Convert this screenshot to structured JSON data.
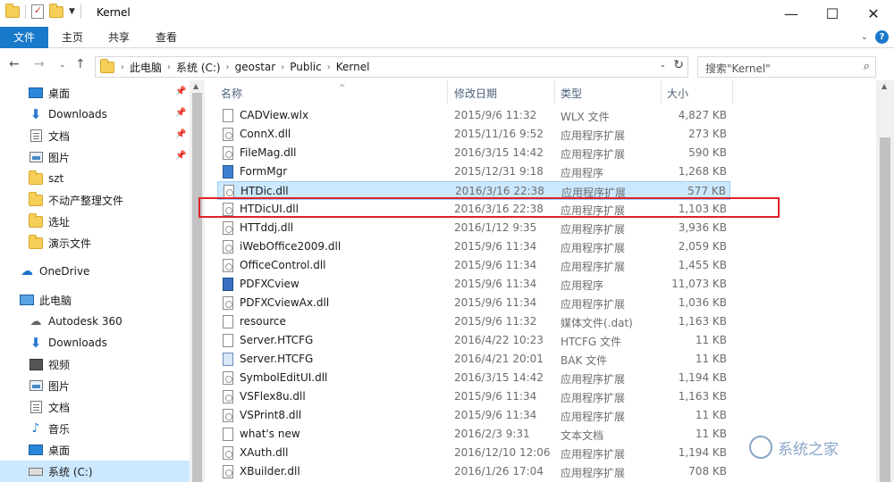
{
  "window": {
    "title": "Kernel",
    "controls": [
      "—",
      "☐",
      "✕"
    ]
  },
  "ribbon": {
    "tabs": [
      "文件",
      "主页",
      "共享",
      "查看"
    ]
  },
  "address": {
    "crumbs": [
      "此电脑",
      "系统 (C:)",
      "geostar",
      "Public",
      "Kernel"
    ]
  },
  "search": {
    "placeholder": "搜索\"Kernel\""
  },
  "nav": {
    "items": [
      {
        "label": "桌面",
        "icon": "desktop-icon",
        "pinned": true
      },
      {
        "label": "Downloads",
        "icon": "downloads-icon",
        "pinned": true
      },
      {
        "label": "文档",
        "icon": "documents-icon",
        "pinned": true
      },
      {
        "label": "图片",
        "icon": "pictures-icon",
        "pinned": true
      },
      {
        "label": "szt",
        "icon": "folder-icon",
        "pinned": false
      },
      {
        "label": "不动产整理文件",
        "icon": "folder-icon",
        "pinned": false
      },
      {
        "label": "选址",
        "icon": "folder-icon",
        "pinned": false
      },
      {
        "label": "演示文件",
        "icon": "folder-icon",
        "pinned": false
      },
      {
        "label": "OneDrive",
        "icon": "onedrive-icon",
        "pinned": false
      },
      {
        "label": "此电脑",
        "icon": "this-pc-icon",
        "pinned": false
      },
      {
        "label": "Autodesk 360",
        "icon": "network-location-icon",
        "pinned": false
      },
      {
        "label": "Downloads",
        "icon": "downloads-icon",
        "pinned": false
      },
      {
        "label": "视频",
        "icon": "videos-icon",
        "pinned": false
      },
      {
        "label": "图片",
        "icon": "pictures-icon",
        "pinned": false
      },
      {
        "label": "文档",
        "icon": "documents-icon",
        "pinned": false
      },
      {
        "label": "音乐",
        "icon": "music-icon",
        "pinned": false
      },
      {
        "label": "桌面",
        "icon": "desktop-icon",
        "pinned": false
      },
      {
        "label": "系统 (C:)",
        "icon": "drive-icon",
        "pinned": false
      }
    ]
  },
  "columns": {
    "name": "名称",
    "date": "修改日期",
    "type": "类型",
    "size": "大小"
  },
  "files": [
    {
      "name": "CADView.wlx",
      "date": "2015/9/6 11:32",
      "type": "WLX 文件",
      "size": "4,827 KB",
      "icon": "file-icon"
    },
    {
      "name": "ConnX.dll",
      "date": "2015/11/16 9:52",
      "type": "应用程序扩展",
      "size": "273 KB",
      "icon": "dll-icon"
    },
    {
      "name": "FileMag.dll",
      "date": "2016/3/15 14:42",
      "type": "应用程序扩展",
      "size": "590 KB",
      "icon": "dll-icon"
    },
    {
      "name": "FormMgr",
      "date": "2015/12/31 9:18",
      "type": "应用程序",
      "size": "1,268 KB",
      "icon": "exe-icon"
    },
    {
      "name": "HTDic.dll",
      "date": "2016/3/16 22:38",
      "type": "应用程序扩展",
      "size": "577 KB",
      "icon": "dll-icon"
    },
    {
      "name": "HTDicUI.dll",
      "date": "2016/3/16 22:38",
      "type": "应用程序扩展",
      "size": "1,103 KB",
      "icon": "dll-icon"
    },
    {
      "name": "HTTddj.dll",
      "date": "2016/1/12 9:35",
      "type": "应用程序扩展",
      "size": "3,936 KB",
      "icon": "dll-icon"
    },
    {
      "name": "iWebOffice2009.dll",
      "date": "2015/9/6 11:34",
      "type": "应用程序扩展",
      "size": "2,059 KB",
      "icon": "dll-icon"
    },
    {
      "name": "OfficeControl.dll",
      "date": "2015/9/6 11:34",
      "type": "应用程序扩展",
      "size": "1,455 KB",
      "icon": "dll-icon"
    },
    {
      "name": "PDFXCview",
      "date": "2015/9/6 11:34",
      "type": "应用程序",
      "size": "11,073 KB",
      "icon": "pdf-app-icon"
    },
    {
      "name": "PDFXCviewAx.dll",
      "date": "2015/9/6 11:34",
      "type": "应用程序扩展",
      "size": "1,036 KB",
      "icon": "dll-icon"
    },
    {
      "name": "resource",
      "date": "2015/9/6 11:32",
      "type": "媒体文件(.dat)",
      "size": "1,163 KB",
      "icon": "file-icon"
    },
    {
      "name": "Server.HTCFG",
      "date": "2016/4/22 10:23",
      "type": "HTCFG 文件",
      "size": "11 KB",
      "icon": "file-icon"
    },
    {
      "name": "Server.HTCFG",
      "date": "2016/4/21 20:01",
      "type": "BAK 文件",
      "size": "11 KB",
      "icon": "cfg-icon"
    },
    {
      "name": "SymbolEditUI.dll",
      "date": "2016/3/15 14:42",
      "type": "应用程序扩展",
      "size": "1,194 KB",
      "icon": "dll-icon"
    },
    {
      "name": "VSFlex8u.dll",
      "date": "2015/9/6 11:34",
      "type": "应用程序扩展",
      "size": "1,163 KB",
      "icon": "dll-icon"
    },
    {
      "name": "VSPrint8.dll",
      "date": "2015/9/6 11:34",
      "type": "应用程序扩展",
      "size": "11 KB",
      "icon": "dll-icon"
    },
    {
      "name": "what's new",
      "date": "2016/2/3 9:31",
      "type": "文本文档",
      "size": "11 KB",
      "icon": "file-icon"
    },
    {
      "name": "XAuth.dll",
      "date": "2016/12/10 12:06",
      "type": "应用程序扩展",
      "size": "1,194 KB",
      "icon": "dll-icon"
    },
    {
      "name": "XBuilder.dll",
      "date": "2016/1/26 17:04",
      "type": "应用程序扩展",
      "size": "708 KB",
      "icon": "dll-icon"
    }
  ],
  "selected_row": 4,
  "highlighted_row": 5,
  "watermark": {
    "text": "系统之家"
  }
}
